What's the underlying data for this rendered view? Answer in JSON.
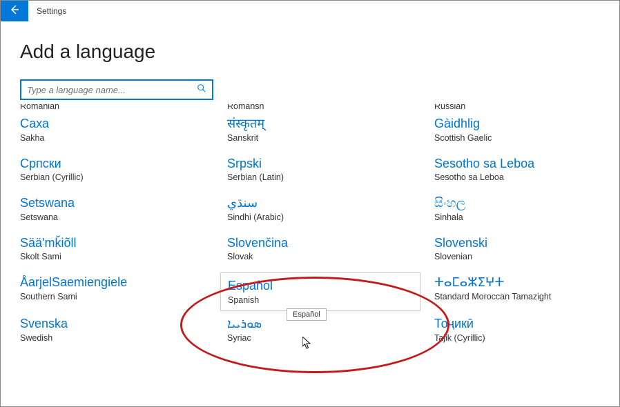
{
  "titlebar": {
    "app_title": "Settings"
  },
  "header": {
    "page_title": "Add a language"
  },
  "search": {
    "placeholder": "Type a language name..."
  },
  "partial_row": {
    "col1": "Romanian",
    "col2": "Romansh",
    "col3": "Russian"
  },
  "rows": [
    [
      {
        "native": "Саха",
        "english": "Sakha"
      },
      {
        "native": "संस्कृतम्",
        "english": "Sanskrit"
      },
      {
        "native": "Gàidhlig",
        "english": "Scottish Gaelic"
      }
    ],
    [
      {
        "native": "Српски",
        "english": "Serbian (Cyrillic)"
      },
      {
        "native": "Srpski",
        "english": "Serbian (Latin)"
      },
      {
        "native": "Sesotho sa Leboa",
        "english": "Sesotho sa Leboa"
      }
    ],
    [
      {
        "native": "Setswana",
        "english": "Setswana"
      },
      {
        "native": "سنڌي",
        "english": "Sindhi (Arabic)"
      },
      {
        "native": "සිංහල",
        "english": "Sinhala"
      }
    ],
    [
      {
        "native": "Sääʹmǩiõll",
        "english": "Skolt Sami"
      },
      {
        "native": "Slovenčina",
        "english": "Slovak"
      },
      {
        "native": "Slovenski",
        "english": "Slovenian"
      }
    ],
    [
      {
        "native": "Åarjel​Saemien​giele",
        "english": "Southern Sami"
      },
      {
        "native": "Español",
        "english": "Spanish",
        "highlight": true
      },
      {
        "native": "ⵜⴰⵎⴰⵣⵉⵖⵜ",
        "english": "Standard Moroccan Tamazight"
      }
    ],
    [
      {
        "native": "Svenska",
        "english": "Swedish"
      },
      {
        "native": "ܣܘܪܝܝܐ",
        "english": "Syriac"
      },
      {
        "native": "Тоҷикӣ",
        "english": "Tajik (Cyrillic)"
      }
    ]
  ],
  "tooltip": {
    "text": "Español"
  }
}
